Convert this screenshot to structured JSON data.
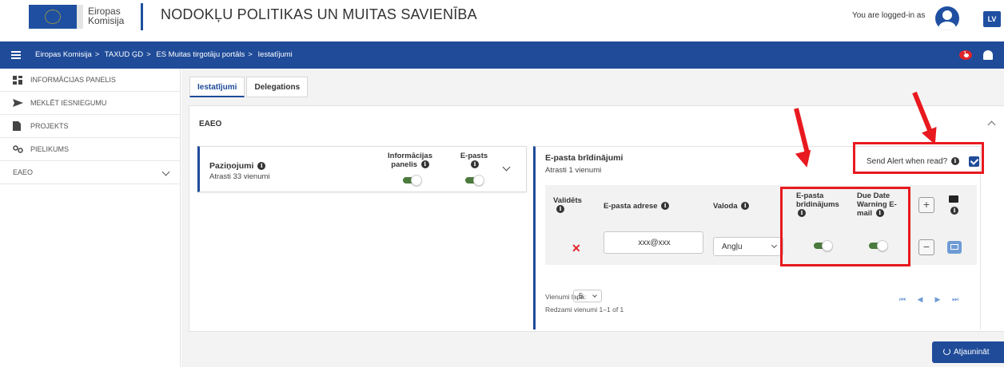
{
  "header": {
    "logo_text": "Eiropas Komisija",
    "site_title": "NODOKĻU POLITIKAS UN MUITAS SAVIENĪBA",
    "logged_in_label": "You are logged-in as",
    "language_code": "LV"
  },
  "breadcrumb": [
    "Eiropas Komisija",
    "TAXUD ĢD",
    "ES Muitas tirgotāju portāls",
    "Iestatījumi"
  ],
  "breadcrumb_separator": ">",
  "notifications_badge": "1",
  "sidebar": {
    "items": [
      {
        "label": "INFORMĀCIJAS PANELIS",
        "icon": "dashboard-icon"
      },
      {
        "label": "MEKLĒT IESNIEGUMU",
        "icon": "send-icon"
      },
      {
        "label": "PROJEKTS",
        "icon": "document-icon"
      },
      {
        "label": "PIELIKUMS",
        "icon": "attachment-icon"
      },
      {
        "label": "EAEO",
        "icon": "chevron-down-icon"
      }
    ]
  },
  "tabs": [
    {
      "label": "Iestatījumi",
      "active": true
    },
    {
      "label": "Delegations",
      "active": false
    }
  ],
  "section": {
    "title": "EAEO"
  },
  "notifications_panel": {
    "title": "Paziņojumi",
    "subtitle": "Atrasti 33 vienumi",
    "col_dashboard": "Informācijas panelis",
    "col_email": "E-pasts",
    "dashboard_enabled": true,
    "email_enabled": true
  },
  "email_alerts_panel": {
    "title": "E-pasta brīdinājumi",
    "subtitle": "Atrasti 1 vienumi",
    "send_alert_label": "Send Alert when read?",
    "send_alert_checked": true,
    "columns": {
      "validated": "Validēts",
      "email_address": "E-pasta adrese",
      "language": "Valoda",
      "email_alert": "E-pasta brīdinājums",
      "due_date_warning": "Due Date Warning E-mail"
    },
    "rows": [
      {
        "validated": "✕",
        "email": "xxx@xxx",
        "language": "Angļu",
        "email_alert": true,
        "due_date_warning": true
      }
    ],
    "per_page_label": "Vienumi lapā:",
    "per_page_value": "5",
    "showing_label": "Redzami vienumi 1–1 of 1",
    "pager": [
      "⏮",
      "◀",
      "▶",
      "⏭"
    ]
  },
  "refresh_button": "Atjaunināt",
  "colors": {
    "brand_blue": "#1f4b99",
    "highlight_red": "#e8191f",
    "toggle_green": "#4a7a3c"
  }
}
